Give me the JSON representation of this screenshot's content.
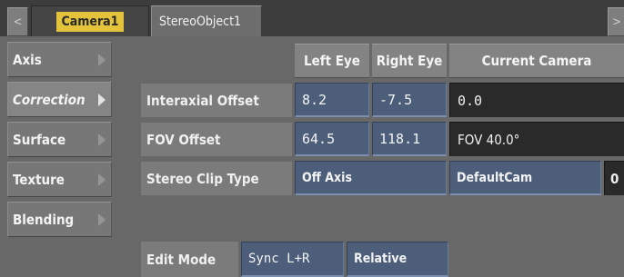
{
  "tabs": {
    "scroll_left": "<",
    "scroll_right": ">",
    "camera_tab": "Camera1",
    "stereo_tab": "StereoObject1"
  },
  "menu": {
    "items": [
      {
        "label": "Axis"
      },
      {
        "label": "Correction",
        "active": true
      },
      {
        "label": "Surface"
      },
      {
        "label": "Texture"
      },
      {
        "label": "Blending"
      }
    ]
  },
  "columns": {
    "left_eye": "Left Eye",
    "right_eye": "Right Eye",
    "current_camera": "Current Camera"
  },
  "rows": {
    "interaxial": {
      "label": "Interaxial Offset",
      "left": "8.2",
      "right": "-7.5",
      "current": "0.0"
    },
    "fov": {
      "label": "FOV Offset",
      "left": "64.5",
      "right": "118.1",
      "current": "FOV 40.0°"
    },
    "clip_type": {
      "label": "Stereo Clip Type",
      "value": "Off Axis",
      "camera": "DefaultCam",
      "extra": "0"
    }
  },
  "edit_mode": {
    "label": "Edit Mode",
    "sync": "Sync L+R",
    "relative": "Relative"
  },
  "colors": {
    "field_blue": "#4c5e79",
    "camera_tab_yellow": "#e3c23c",
    "panel_gray": "#686868"
  }
}
